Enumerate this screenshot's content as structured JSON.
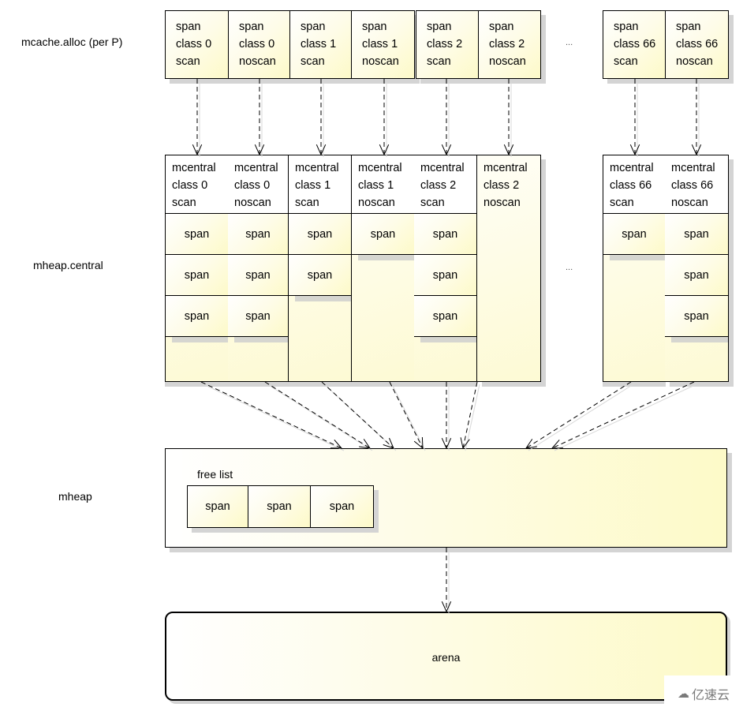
{
  "row_labels": {
    "mcache": "mcache.alloc (per P)",
    "mcentral": "mheap.central",
    "mheap": "mheap"
  },
  "ellipsis": "...",
  "mcache_cells": [
    {
      "lines": [
        "span",
        "class 0",
        "scan"
      ]
    },
    {
      "lines": [
        "span",
        "class 0",
        "noscan"
      ]
    },
    {
      "lines": [
        "span",
        "class 1",
        "scan"
      ]
    },
    {
      "lines": [
        "span",
        "class 1",
        "noscan"
      ]
    },
    {
      "lines": [
        "span",
        "class 2",
        "scan"
      ]
    },
    {
      "lines": [
        "span",
        "class 2",
        "noscan"
      ]
    },
    {
      "lines": [
        "span",
        "class 66",
        "scan"
      ]
    },
    {
      "lines": [
        "span",
        "class 66",
        "noscan"
      ]
    }
  ],
  "mcentral_columns": [
    {
      "lines": [
        "mcentral",
        "class 0",
        "scan"
      ],
      "span_count": 3
    },
    {
      "lines": [
        "mcentral",
        "class 0",
        "noscan"
      ],
      "span_count": 3
    },
    {
      "lines": [
        "mcentral",
        "class 1",
        "scan"
      ],
      "span_count": 2
    },
    {
      "lines": [
        "mcentral",
        "class 1",
        "noscan"
      ],
      "span_count": 1
    },
    {
      "lines": [
        "mcentral",
        "class 2",
        "scan"
      ],
      "span_count": 3
    },
    {
      "lines": [
        "mcentral",
        "class 2",
        "noscan"
      ],
      "span_count": 0
    },
    {
      "lines": [
        "mcentral",
        "class 66",
        "scan"
      ],
      "span_count": 1
    },
    {
      "lines": [
        "mcentral",
        "class 66",
        "noscan"
      ],
      "span_count": 3
    }
  ],
  "span_label": "span",
  "mheap": {
    "free_list_label": "free list",
    "free_list_spans": [
      "span",
      "span",
      "span"
    ]
  },
  "arena": {
    "label": "arena"
  },
  "watermark": {
    "text": "亿速云"
  }
}
